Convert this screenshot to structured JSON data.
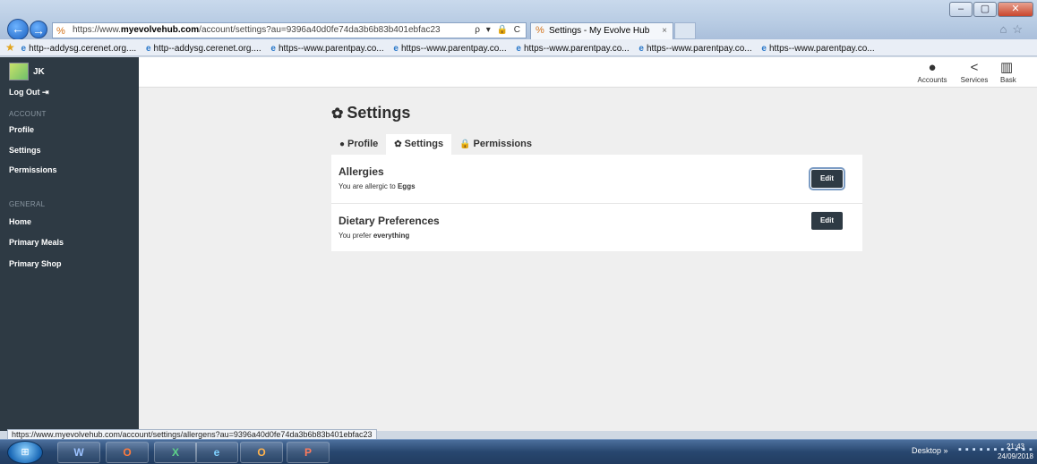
{
  "browser": {
    "address": {
      "scheme": "https://www.",
      "host": "myevolvehub.com",
      "path": "/account/settings?au=9396a40d0fe74da3b6b83b401ebfac23",
      "tools": "ρ ▾ 🔒 C"
    },
    "tab_title": "Settings - My Evolve Hub",
    "tab_close": "×",
    "favorites": [
      "http--addysg.cerenet.org....",
      "http--addysg.cerenet.org....",
      "https--www.parentpay.co...",
      "https--www.parentpay.co...",
      "https--www.parentpay.co...",
      "https--www.parentpay.co...",
      "https--www.parentpay.co..."
    ]
  },
  "sidebar": {
    "user_initials": "JK",
    "logout_label": "Log Out",
    "account_heading": "ACCOUNT",
    "account_items": [
      "Profile",
      "Settings",
      "Permissions"
    ],
    "general_heading": "GENERAL",
    "general_items": [
      "Home",
      "Primary Meals",
      "Primary Shop"
    ]
  },
  "topbar": {
    "actions": [
      "Accounts",
      "Services",
      "Bask"
    ]
  },
  "main": {
    "title": "Settings",
    "tabs": [
      "Profile",
      "Settings",
      "Permissions"
    ],
    "active_tab": "Settings",
    "rows": [
      {
        "title": "Allergies",
        "text_prefix": "You are allergic to ",
        "text_value": "Eggs",
        "button": "Edit"
      },
      {
        "title": "Dietary Preferences",
        "text_prefix": "You prefer ",
        "text_value": "everything",
        "button": "Edit"
      }
    ]
  },
  "statusbar": {
    "url": "https://www.myevolvehub.com/account/settings/allergens?au=9396a40d0fe74da3b6b83b401ebfac23"
  },
  "taskbar": {
    "desktop_label": "Desktop",
    "apps": [
      "W",
      "O",
      "X",
      "e",
      "O",
      "P"
    ],
    "time": "21:43",
    "date": "24/09/2018"
  },
  "colors": {
    "sidebar": "#2e3a44",
    "page_bg": "#efefef",
    "button": "#2e3a44"
  }
}
